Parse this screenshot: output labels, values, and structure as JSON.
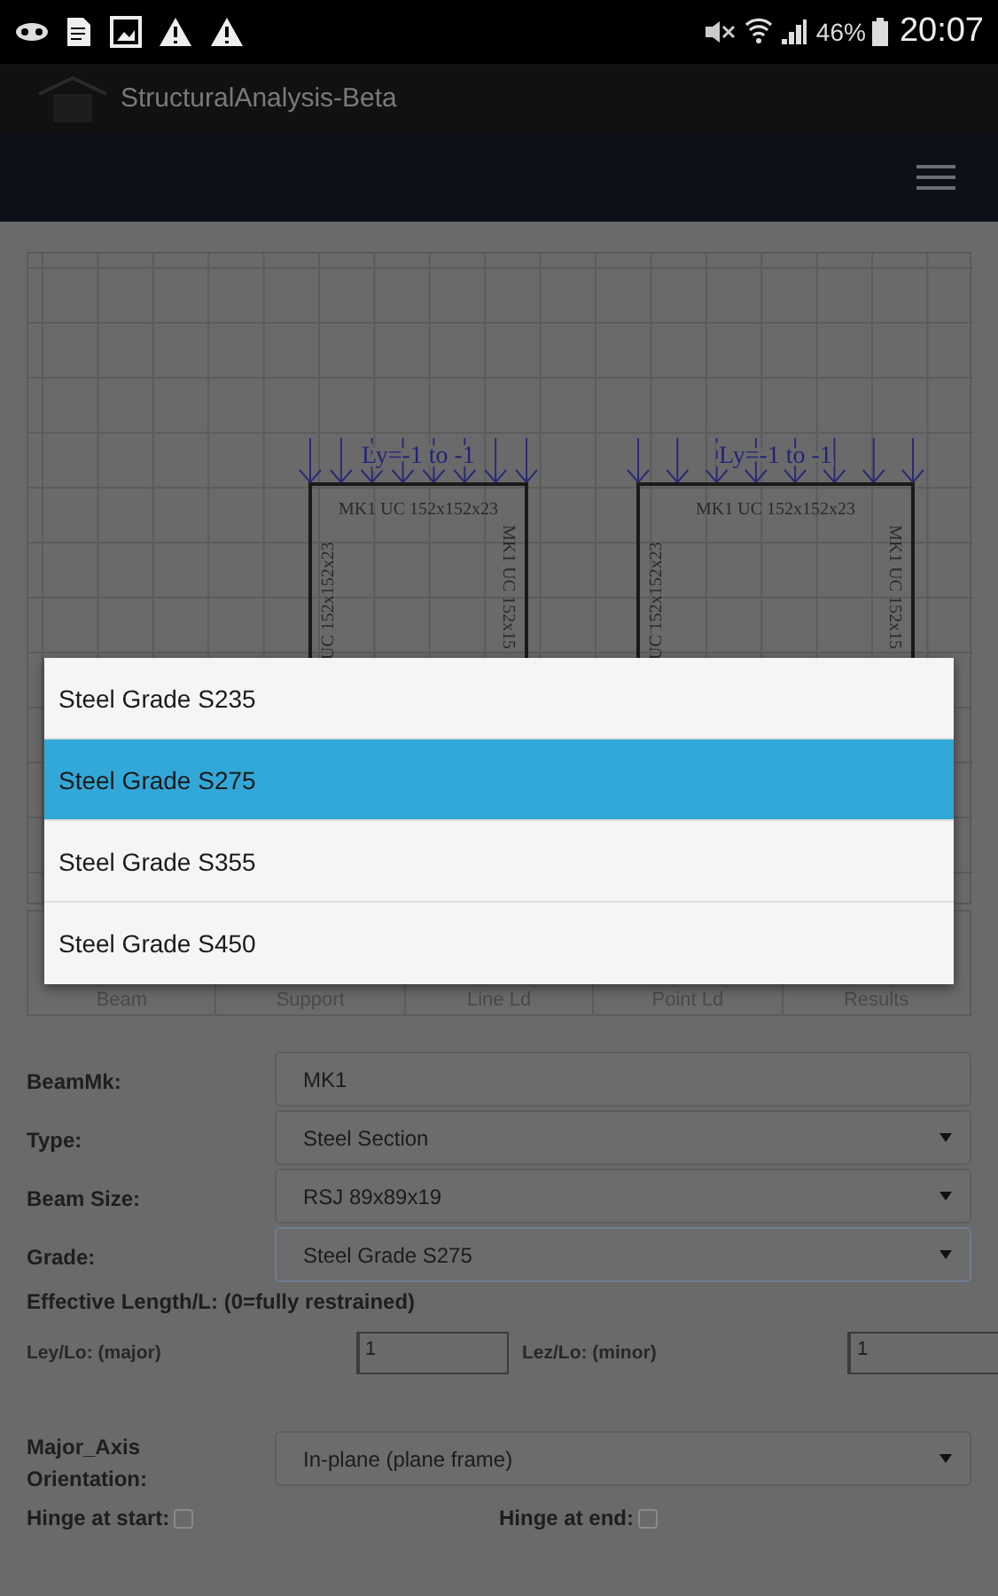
{
  "status_bar": {
    "battery": "46%",
    "time": "20:07"
  },
  "app_bar": {
    "title": "StructuralAnalysis-Beta"
  },
  "canvas": {
    "frames": [
      {
        "load_label": "Ly=-1 to -1",
        "beam_label": "MK1 UC 152x152x23",
        "left_column_label": "UC 152x152x23",
        "right_column_label": "MK1 UC 152x15"
      },
      {
        "load_label": "Ly=-1 to -1",
        "beam_label": "MK1 UC 152x152x23",
        "left_column_label": "UC 152x152x23",
        "right_column_label": "MK1 UC 152x15"
      }
    ]
  },
  "toolbar": {
    "tabs": [
      {
        "label": "Beam"
      },
      {
        "label": "Support"
      },
      {
        "label": "Line Ld"
      },
      {
        "label": "Point Ld"
      },
      {
        "label": "Results"
      }
    ]
  },
  "form": {
    "fields": [
      {
        "label": "BeamMk:",
        "kind": "text",
        "value": "MK1",
        "focused": false
      },
      {
        "label": "Type:",
        "kind": "select",
        "value": "Steel Section",
        "focused": false
      },
      {
        "label": "Beam Size:",
        "kind": "select",
        "value": "RSJ 89x89x19",
        "focused": false
      },
      {
        "label": "Grade:",
        "kind": "select",
        "value": "Steel Grade S275",
        "focused": true
      }
    ],
    "effective_length": {
      "heading": "Effective Length/L: (0=fully restrained)",
      "major_label": "Ley/Lo: (major)",
      "major_value": "1",
      "minor_label": "Lez/Lo: (minor)",
      "minor_value": "1"
    },
    "orientation": {
      "label_lines": [
        "Major_Axis",
        "Orientation:"
      ],
      "value": "In-plane (plane frame)"
    },
    "hinges": [
      {
        "label": "Hinge at start:",
        "checked": false
      },
      {
        "label": "Hinge at end:",
        "checked": false
      }
    ]
  },
  "dropdown": {
    "options": [
      {
        "label": "Steel Grade S235",
        "selected": false
      },
      {
        "label": "Steel Grade S275",
        "selected": true
      },
      {
        "label": "Steel Grade S355",
        "selected": false
      },
      {
        "label": "Steel Grade S450",
        "selected": false
      }
    ]
  }
}
